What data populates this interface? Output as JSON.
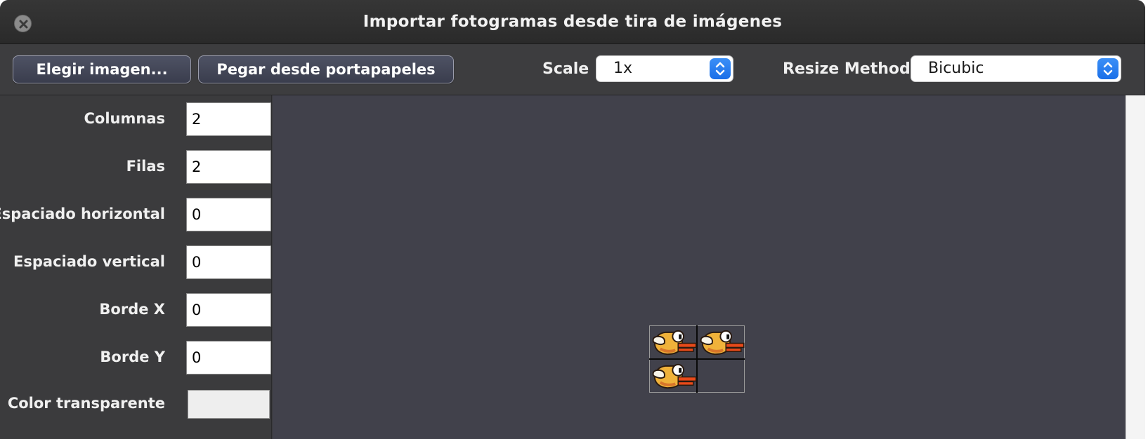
{
  "window": {
    "title": "Importar fotogramas desde tira de imágenes",
    "close_icon": "close-icon"
  },
  "toolbar": {
    "choose_image_label": "Elegir imagen...",
    "paste_label": "Pegar desde portapapeles",
    "scale_label": "Scale",
    "scale_value": "1x",
    "resize_method_label": "Resize Method",
    "resize_method_value": "Bicubic"
  },
  "fields": {
    "columns": {
      "label": "Columnas",
      "value": "2"
    },
    "rows": {
      "label": "Filas",
      "value": "2"
    },
    "h_spacing": {
      "label": "Espaciado horizontal",
      "value": "0"
    },
    "v_spacing": {
      "label": "Espaciado vertical",
      "value": "0"
    },
    "border_x": {
      "label": "Borde X",
      "value": "0"
    },
    "border_y": {
      "label": "Borde Y",
      "value": "0"
    },
    "transparent_color": {
      "label": "Color transparente",
      "value_color": "#eeeeee"
    }
  },
  "preview": {
    "grid_columns": 2,
    "grid_rows": 2,
    "frames": [
      "bird-sprite",
      "bird-sprite",
      "bird-sprite",
      "empty"
    ]
  },
  "colors": {
    "accent": "#1a6fe8",
    "preview_bg": "#41414b",
    "panel_bg": "#3b3b3d"
  }
}
